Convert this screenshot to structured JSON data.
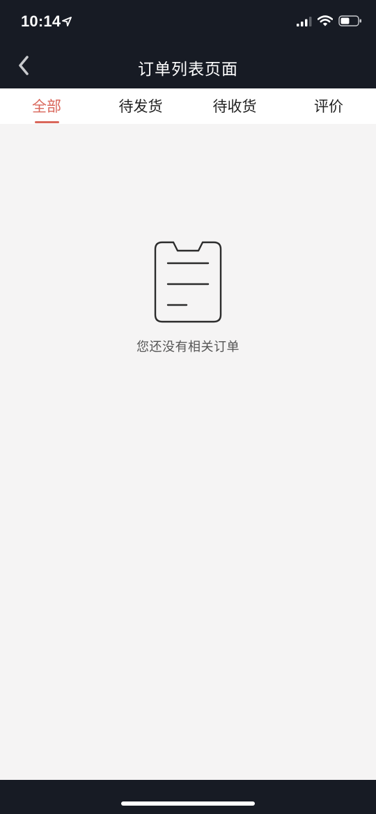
{
  "status_bar": {
    "time": "10:14",
    "icons": [
      "location-arrow-icon",
      "signal-icon",
      "wifi-icon",
      "battery-icon"
    ]
  },
  "nav_bar": {
    "title": "订单列表页面",
    "back_icon": "chevron-left-icon"
  },
  "tabs": [
    {
      "label": "全部",
      "active": true
    },
    {
      "label": "待发货",
      "active": false
    },
    {
      "label": "待收货",
      "active": false
    },
    {
      "label": "评价",
      "active": false
    }
  ],
  "empty_state": {
    "icon": "clipboard-icon",
    "message": "您还没有相关订单"
  },
  "colors": {
    "bar_background": "#171b24",
    "accent": "#d9665a",
    "page_background": "#f5f4f4"
  }
}
